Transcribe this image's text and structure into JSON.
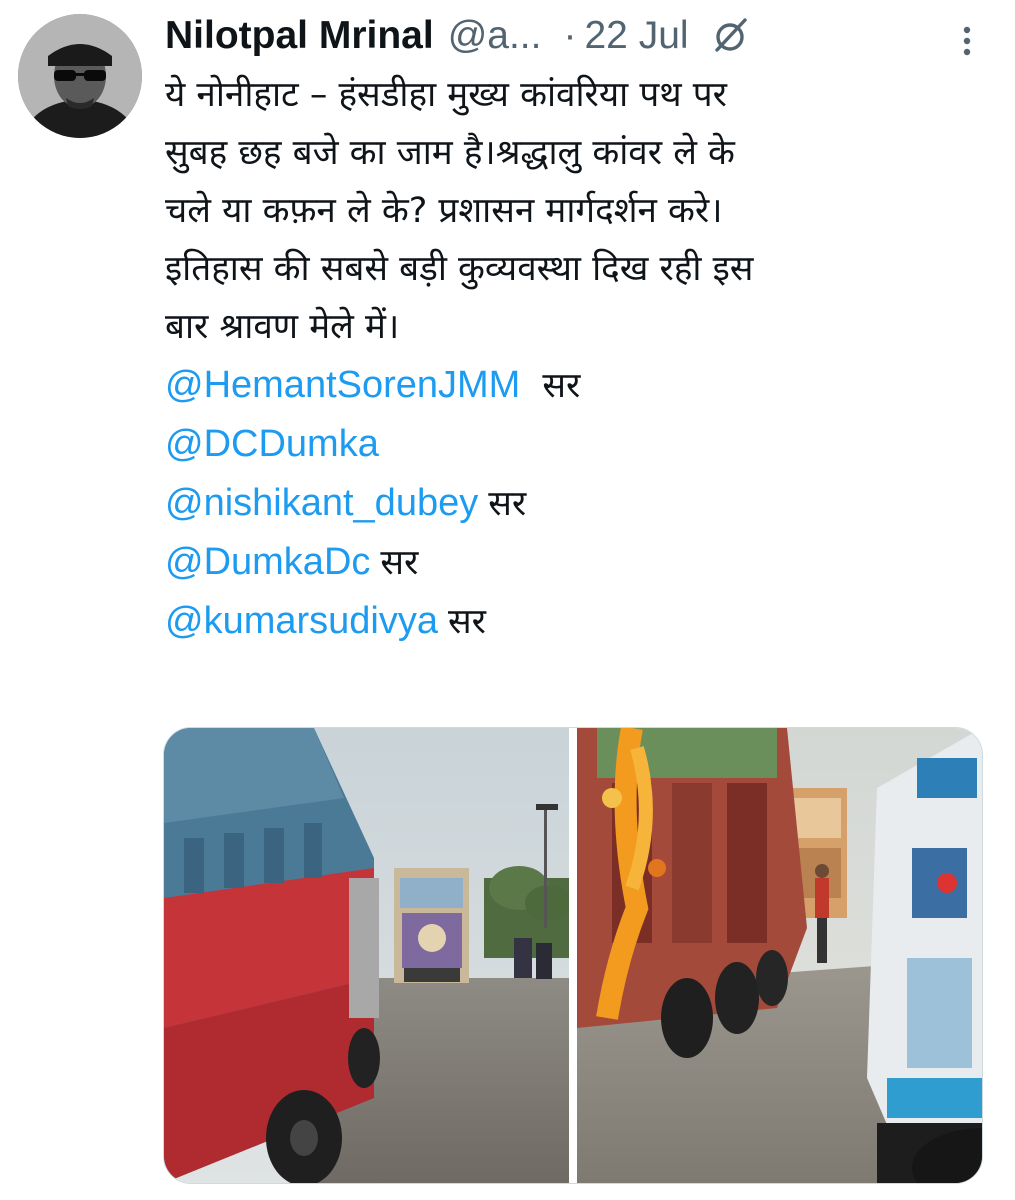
{
  "tweet": {
    "author": {
      "display_name": "Nilotpal Mrinal",
      "handle": "@a...",
      "avatar_icon": "user-avatar"
    },
    "separator": "·",
    "date": "22 Jul",
    "text_lines": [
      "ये नोनीहाट – हंसडीहा मुख्य कांवरिया पथ पर",
      "सुबह छह बजे का जाम है।श्रद्धालु कांवर ले के",
      "चले या कफ़न ले के? प्रशासन मार्गदर्शन करे।",
      "इतिहास की सबसे बड़ी कुव्यवस्था दिख रही इस",
      "बार श्रावण मेले में।"
    ],
    "mentions": [
      {
        "handle": "@HemantSorenJMM",
        "suffix": "सर"
      },
      {
        "handle": "@DCDumka",
        "suffix": ""
      },
      {
        "handle": "@nishikant_dubey",
        "suffix": "सर"
      },
      {
        "handle": "@DumkaDc",
        "suffix": "सर"
      },
      {
        "handle": "@kumarsudivya",
        "suffix": "सर"
      }
    ],
    "media": [
      {
        "name": "trucks-road-photo-1"
      },
      {
        "name": "trucks-road-photo-2"
      }
    ],
    "colors": {
      "text": "#0f1419",
      "secondary": "#536471",
      "link": "#1d9bf0"
    }
  }
}
